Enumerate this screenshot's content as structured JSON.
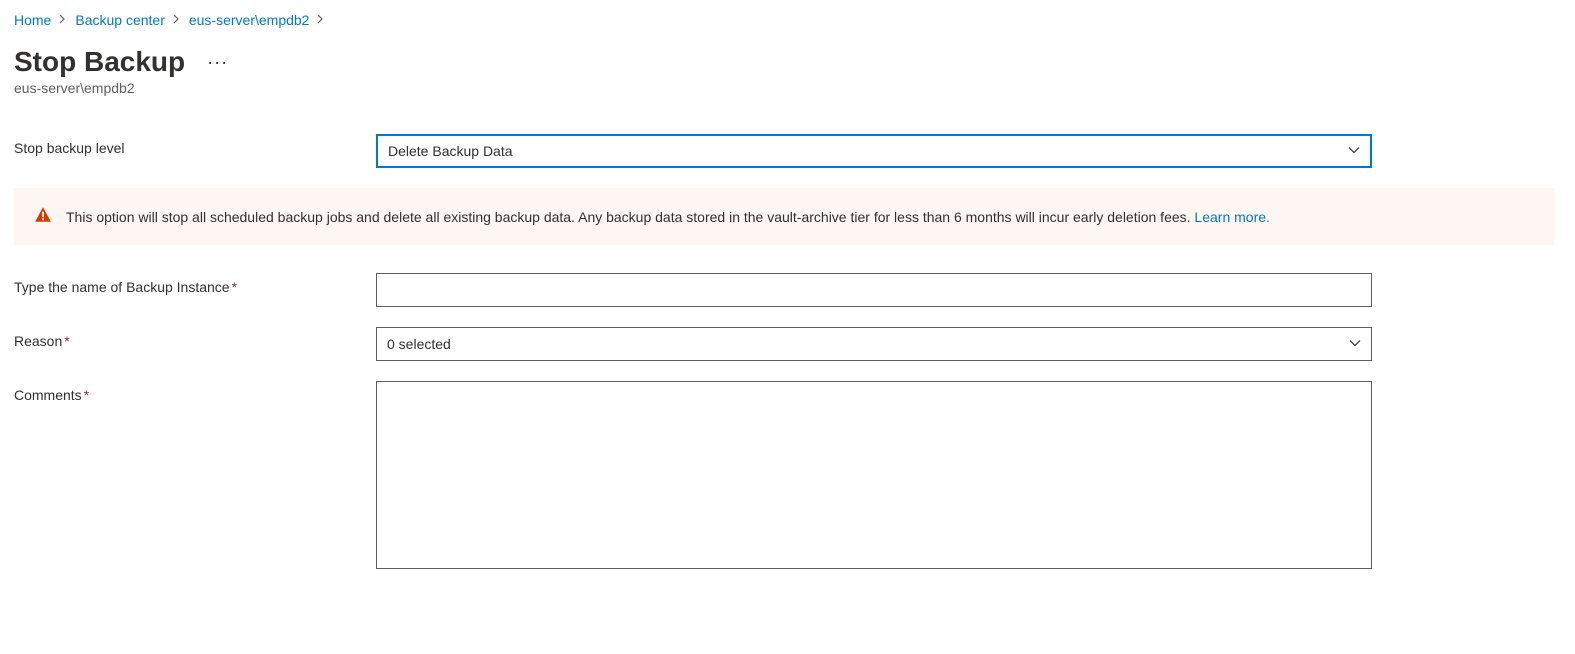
{
  "breadcrumb": {
    "items": [
      "Home",
      "Backup center",
      "eus-server\\empdb2"
    ]
  },
  "page": {
    "title": "Stop Backup",
    "subtitle": "eus-server\\empdb2"
  },
  "form": {
    "stop_level": {
      "label": "Stop backup level",
      "value": "Delete Backup Data"
    },
    "warning": {
      "text": "This option will stop all scheduled backup jobs and delete all existing backup data. Any backup data stored in the vault-archive tier for less than 6 months will incur early deletion fees. ",
      "learn_more": "Learn more."
    },
    "instance_name": {
      "label": "Type the name of Backup Instance",
      "value": ""
    },
    "reason": {
      "label": "Reason",
      "value": "0 selected"
    },
    "comments": {
      "label": "Comments",
      "value": ""
    }
  }
}
